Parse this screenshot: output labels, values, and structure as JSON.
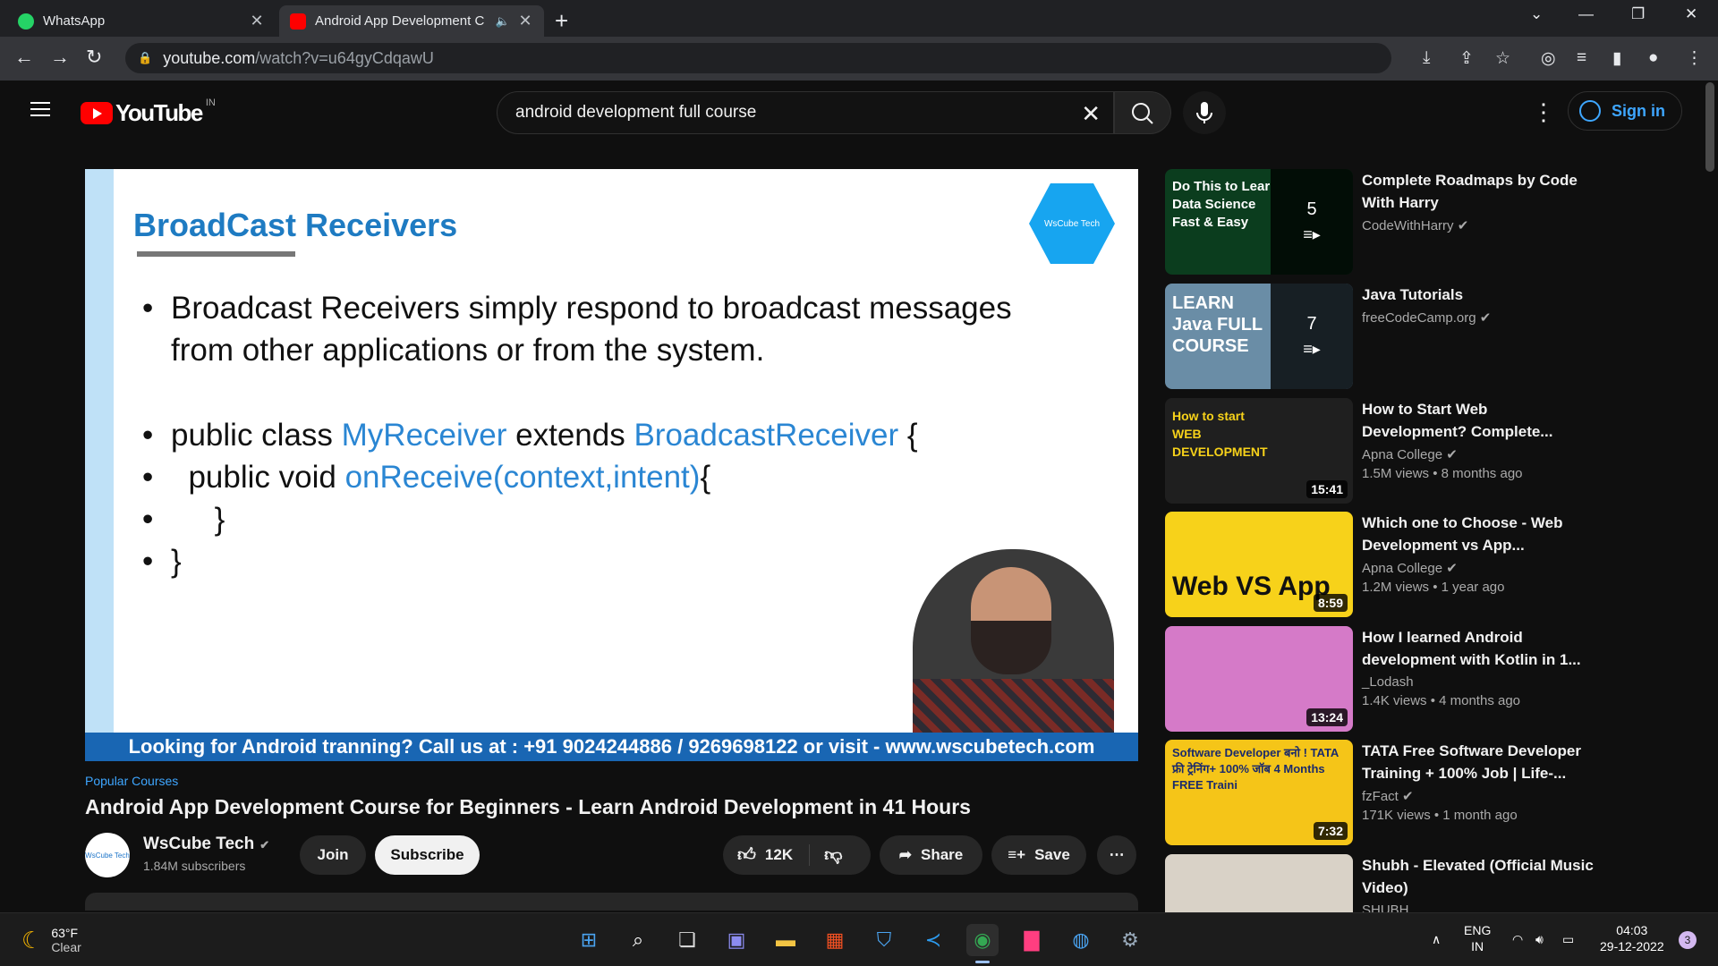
{
  "browser": {
    "tabs": [
      {
        "title": "WhatsApp",
        "active": false,
        "favicon_color": "#25d366"
      },
      {
        "title": "Android App Development C",
        "active": true,
        "favicon_color": "#ff0000"
      }
    ],
    "url_host": "youtube.com",
    "url_path": "/watch?v=u64gyCdqawU"
  },
  "youtube": {
    "logo_text": "YouTube",
    "country_code": "IN",
    "search_value": "android development full course",
    "sign_in_label": "Sign in"
  },
  "video": {
    "slide": {
      "title": "BroadCast Receivers",
      "logo_text": "WsCube Tech",
      "line1a": "Broadcast  Receivers  simply  respond  to  broadcast  messages",
      "line1b": "from other applications or from the system.",
      "code1_pre": "public class ",
      "code1_class": "MyReceiver",
      "code1_mid": "  extends  ",
      "code1_parent": "BroadcastReceiver",
      "code1_post": " {",
      "code2_pre": "  public void ",
      "code2_method": "onReceive(context,intent)",
      "code2_post": "{",
      "code3": "",
      "code4": "     }",
      "code5": "}",
      "banner": "Looking for Android tranning? Call us at : +91 9024244886 / 9269698122 or visit - www.wscubetech.com"
    },
    "hashtag": "Popular Courses",
    "title": "Android App Development Course for Beginners - Learn Android Development in 41 Hours",
    "channel": {
      "name": "WsCube Tech",
      "subscribers": "1.84M subscribers",
      "avatar_text": "WsCube Tech"
    },
    "actions": {
      "join": "Join",
      "subscribe": "Subscribe",
      "likes": "12K",
      "share": "Share",
      "save": "Save"
    }
  },
  "recommendations": [
    {
      "title": "Complete Roadmaps by Code With Harry",
      "channel": "CodeWithHarry",
      "verified": true,
      "meta": "",
      "badge": "5",
      "playlist": true,
      "thumb_text": "Do This to Lear Data Science Fast & Easy",
      "thumb_color": "#0b3d1e"
    },
    {
      "title": "Java Tutorials",
      "channel": "freeCodeCamp.org",
      "verified": true,
      "meta": "",
      "badge": "7",
      "playlist": true,
      "thumb_text": "LEARN Java FULL COURSE",
      "thumb_color": "#6a8da6"
    },
    {
      "title": "How to Start Web Development? Complete...",
      "channel": "Apna College",
      "verified": true,
      "meta": "1.5M views • 8 months ago",
      "badge": "15:41",
      "playlist": false,
      "thumb_text": "How to start WEB DEVELOPMENT",
      "thumb_color": "#1f1f1f"
    },
    {
      "title": "Which one to Choose - Web Development vs App...",
      "channel": "Apna College",
      "verified": true,
      "meta": "1.2M views • 1 year ago",
      "badge": "8:59",
      "playlist": false,
      "thumb_text": "Web VS App",
      "thumb_color": "#f7d21a"
    },
    {
      "title": "How I learned Android development with Kotlin in 1...",
      "channel": "_Lodash",
      "verified": false,
      "meta": "1.4K views • 4 months ago",
      "badge": "13:24",
      "playlist": false,
      "thumb_text": "",
      "thumb_color": "#d57ac8"
    },
    {
      "title": "TATA Free Software Developer Training + 100% Job | Life-...",
      "channel": "fzFact",
      "verified": true,
      "meta": "171K views • 1 month ago",
      "badge": "7:32",
      "playlist": false,
      "thumb_text": "Software Developer बनो ! TATA फ्री ट्रेनिंग+ 100% जॉब 4 Months FREE Traini",
      "thumb_color": "#f5c518"
    },
    {
      "title": "Shubh - Elevated (Official Music Video)",
      "channel": "SHUBH",
      "verified": false,
      "meta": "",
      "badge": "",
      "playlist": false,
      "thumb_text": "",
      "thumb_color": "#d9d2c7"
    }
  ],
  "taskbar": {
    "temperature": "63°F",
    "condition": "Clear",
    "lang1": "ENG",
    "lang2": "IN",
    "time": "04:03",
    "date": "29-12-2022",
    "notifications": "3"
  }
}
